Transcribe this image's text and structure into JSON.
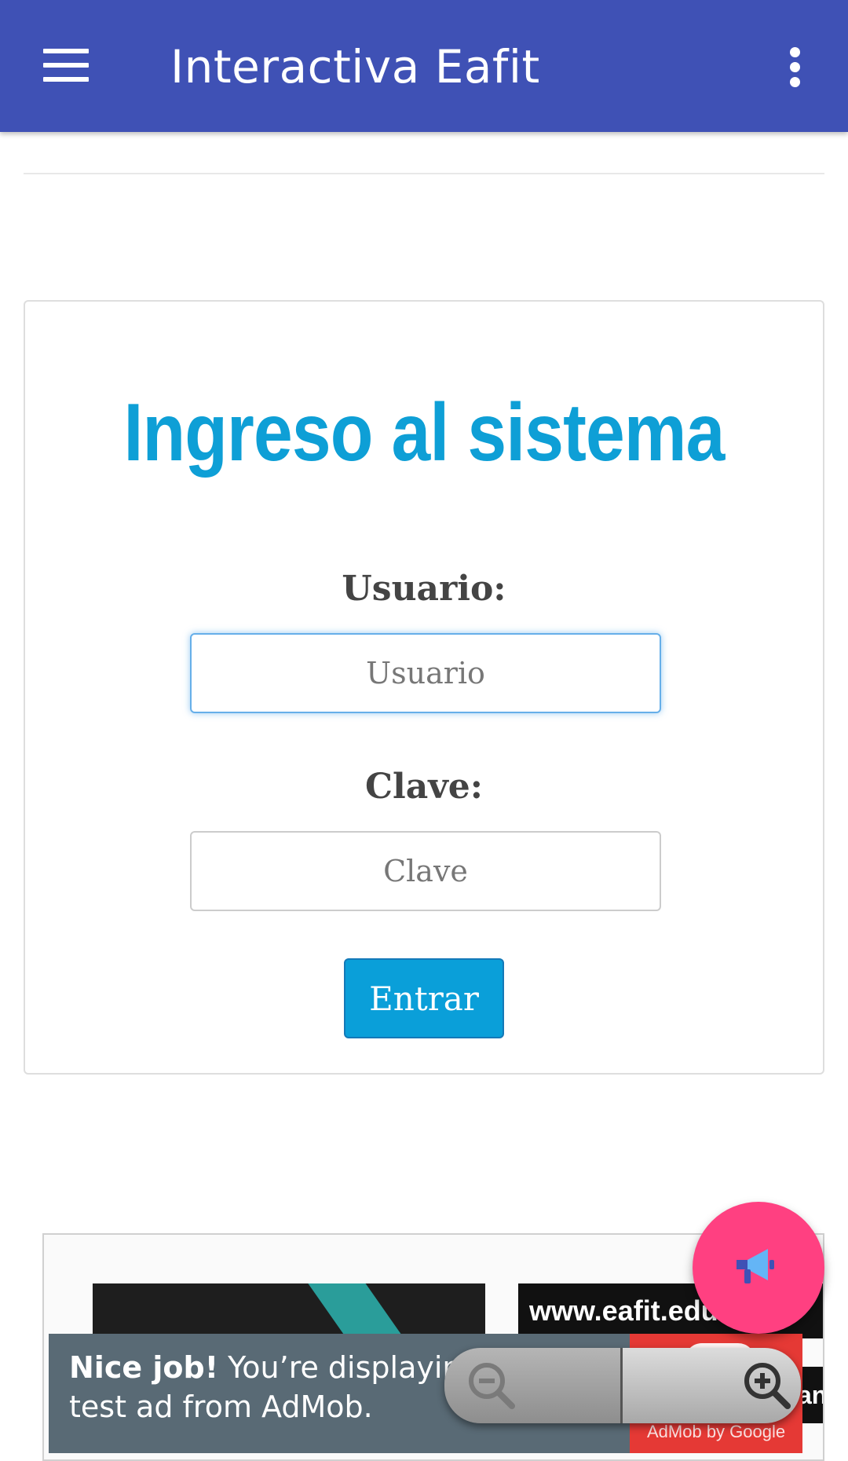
{
  "appbar": {
    "title": "Interactiva Eafit",
    "menu_icon": "hamburger-menu-icon",
    "overflow_icon": "more-vert-icon",
    "color": "#3f51b5"
  },
  "login": {
    "heading": "Ingreso al sistema",
    "user_label": "Usuario:",
    "user_placeholder": "Usuario",
    "user_value": "",
    "pass_label": "Clave:",
    "pass_placeholder": "Clave",
    "pass_value": "",
    "submit_label": "Entrar",
    "heading_color": "#0e9fd6",
    "button_color": "#0a9fd9"
  },
  "ad": {
    "image_right_text": "www.eafit.edu.",
    "image_right2_text": "an",
    "banner_bold": "Nice job!",
    "banner_text_1": " You’re displaying a",
    "banner_text_2": "test ad from AdMob.",
    "brand": "AdMob by Google",
    "zoom_out_icon": "zoom-out-icon",
    "zoom_in_icon": "zoom-in-icon"
  },
  "fab": {
    "icon": "megaphone-icon",
    "color": "#ff4081"
  }
}
